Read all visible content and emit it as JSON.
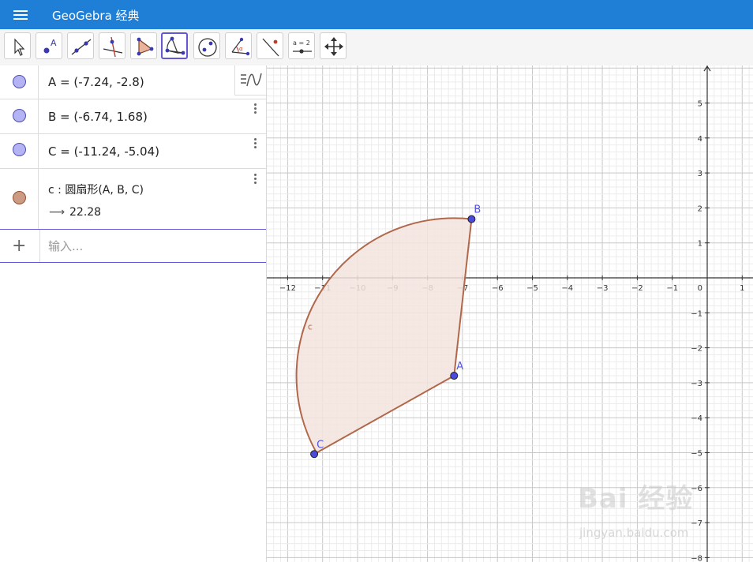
{
  "app": {
    "title": "GeoGebra 经典"
  },
  "toolbar": {
    "tools": [
      {
        "name": "move-tool",
        "icon": "arrow-cursor-icon"
      },
      {
        "name": "point-tool",
        "icon": "point-icon"
      },
      {
        "name": "line-tool",
        "icon": "line-icon"
      },
      {
        "name": "perpendicular-line-tool",
        "icon": "perpendicular-icon"
      },
      {
        "name": "polygon-tool",
        "icon": "polygon-icon"
      },
      {
        "name": "circular-sector-tool",
        "icon": "sector-icon",
        "selected": true
      },
      {
        "name": "circle-tool",
        "icon": "circle-icon"
      },
      {
        "name": "angle-tool",
        "icon": "angle-icon"
      },
      {
        "name": "reflect-tool",
        "icon": "reflect-icon"
      },
      {
        "name": "slider-tool",
        "icon": "slider-icon"
      },
      {
        "name": "move-graphics-view-tool",
        "icon": "move-view-icon"
      }
    ],
    "slider_label": "a = 2"
  },
  "algebra": {
    "rows": [
      {
        "label": "A",
        "definition": "A = (-7.24, -2.8)"
      },
      {
        "label": "B",
        "definition": "B = (-6.74, 1.68)"
      },
      {
        "label": "C",
        "definition": "C = (-11.24, -5.04)"
      }
    ],
    "sector": {
      "definition": "c : 圆扇形(A, B, C)",
      "arrow": "⟶",
      "value": "22.28"
    },
    "input_placeholder": "输入..."
  },
  "graphics": {
    "x_ticks": [
      "−12",
      "−11",
      "−10",
      "−9",
      "−8",
      "−7",
      "−6",
      "−5",
      "−4",
      "−3",
      "−2",
      "−1",
      "0",
      "1"
    ],
    "y_ticks": [
      "5",
      "4",
      "3",
      "2",
      "1",
      "−1",
      "−2",
      "−3",
      "−4",
      "−5",
      "−6",
      "−7",
      "−8"
    ],
    "points": [
      {
        "name": "A",
        "x": -7.24,
        "y": -2.8
      },
      {
        "name": "B",
        "x": -6.74,
        "y": 1.68
      },
      {
        "name": "C",
        "x": -11.24,
        "y": -5.04
      }
    ],
    "sector_label": "c",
    "colors": {
      "point_fill": "#4a4adb",
      "sector_stroke": "#b0674a",
      "sector_fill": "#f3e4de",
      "label": "#5555dd"
    }
  },
  "watermark": {
    "brand": "Bai 经验",
    "url": "jingyan.baidu.com"
  }
}
